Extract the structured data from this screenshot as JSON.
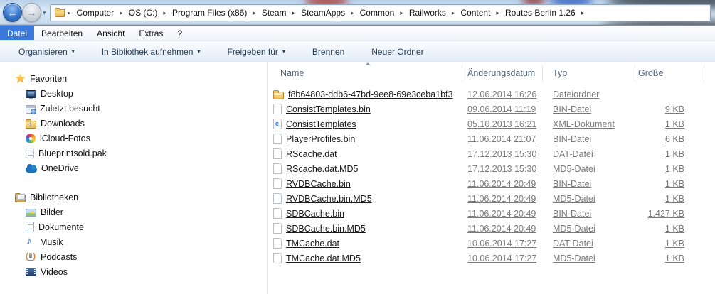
{
  "breadcrumb": {
    "items": [
      "Computer",
      "OS (C:)",
      "Program Files (x86)",
      "Steam",
      "SteamApps",
      "Common",
      "Railworks",
      "Content",
      "Routes Berlin 1.26"
    ],
    "folder_icon": "folder-icon",
    "separator_icon": "chevron-right-icon"
  },
  "nav": {
    "back_icon": "back-arrow-icon",
    "forward_icon": "forward-arrow-icon",
    "back_glyph": "←",
    "forward_glyph": "→",
    "history_dropdown_glyph": "▾"
  },
  "menubar": {
    "items": [
      {
        "label": "Datei",
        "active": true
      },
      {
        "label": "Bearbeiten",
        "active": false
      },
      {
        "label": "Ansicht",
        "active": false
      },
      {
        "label": "Extras",
        "active": false
      },
      {
        "label": "?",
        "active": false
      }
    ]
  },
  "toolbar": {
    "buttons": [
      {
        "label": "Organisieren",
        "dropdown": true
      },
      {
        "label": "In Bibliothek aufnehmen",
        "dropdown": true
      },
      {
        "label": "Freigeben für",
        "dropdown": true
      },
      {
        "label": "Brennen",
        "dropdown": false
      },
      {
        "label": "Neuer Ordner",
        "dropdown": false
      }
    ],
    "dropdown_glyph": "▾"
  },
  "sidebar": {
    "sections": [
      {
        "label": "Favoriten",
        "icon": "star-icon",
        "items": [
          {
            "label": "Desktop",
            "icon": "desktop-icon"
          },
          {
            "label": "Zuletzt besucht",
            "icon": "recent-places-icon"
          },
          {
            "label": "Downloads",
            "icon": "downloads-icon"
          },
          {
            "label": "iCloud-Fotos",
            "icon": "icloud-photos-icon"
          },
          {
            "label": "Blueprintsold.pak",
            "icon": "pak-file-icon"
          },
          {
            "label": "OneDrive",
            "icon": "onedrive-icon"
          }
        ]
      },
      {
        "label": "Bibliotheken",
        "icon": "libraries-icon",
        "items": [
          {
            "label": "Bilder",
            "icon": "pictures-icon"
          },
          {
            "label": "Dokumente",
            "icon": "documents-icon"
          },
          {
            "label": "Musik",
            "icon": "music-icon"
          },
          {
            "label": "Podcasts",
            "icon": "podcasts-icon"
          },
          {
            "label": "Videos",
            "icon": "videos-icon"
          }
        ]
      }
    ]
  },
  "file_list": {
    "columns": [
      "Name",
      "Änderungsdatum",
      "Typ",
      "Größe"
    ],
    "sort": {
      "column": "Name",
      "direction": "ascending"
    },
    "rows": [
      {
        "name": "f8b64803-ddb6-47bd-9ee8-69e3ceba1bf3",
        "date": "12.06.2014 16:26",
        "type": "Dateiordner",
        "size": "",
        "icon": "folder-icon"
      },
      {
        "name": "ConsistTemplates.bin",
        "date": "09.06.2014 11:19",
        "type": "BIN-Datei",
        "size": "9 KB",
        "icon": "file-icon"
      },
      {
        "name": "ConsistTemplates",
        "date": "05.10.2013 16:21",
        "type": "XML-Dokument",
        "size": "1 KB",
        "icon": "xml-file-icon"
      },
      {
        "name": "PlayerProfiles.bin",
        "date": "11.06.2014 21:07",
        "type": "BIN-Datei",
        "size": "6 KB",
        "icon": "file-icon"
      },
      {
        "name": "RScache.dat",
        "date": "17.12.2013 15:30",
        "type": "DAT-Datei",
        "size": "1 KB",
        "icon": "file-icon"
      },
      {
        "name": "RScache.dat.MD5",
        "date": "17.12.2013 15:30",
        "type": "MD5-Datei",
        "size": "1 KB",
        "icon": "file-icon"
      },
      {
        "name": "RVDBCache.bin",
        "date": "11.06.2014 20:49",
        "type": "BIN-Datei",
        "size": "1 KB",
        "icon": "file-icon"
      },
      {
        "name": "RVDBCache.bin.MD5",
        "date": "11.06.2014 20:49",
        "type": "MD5-Datei",
        "size": "1 KB",
        "icon": "file-icon"
      },
      {
        "name": "SDBCache.bin",
        "date": "11.06.2014 20:49",
        "type": "BIN-Datei",
        "size": "1.427 KB",
        "icon": "file-icon"
      },
      {
        "name": "SDBCache.bin.MD5",
        "date": "11.06.2014 20:49",
        "type": "MD5-Datei",
        "size": "1 KB",
        "icon": "file-icon"
      },
      {
        "name": "TMCache.dat",
        "date": "10.06.2014 17:27",
        "type": "DAT-Datei",
        "size": "1 KB",
        "icon": "file-icon"
      },
      {
        "name": "TMCache.dat.MD5",
        "date": "10.06.2014 17:27",
        "type": "MD5-Datei",
        "size": "1 KB",
        "icon": "file-icon"
      }
    ]
  },
  "colors": {
    "menu_highlight": "#3a78dc",
    "toolbar_text": "#1f3b57",
    "header_text": "#4f637b",
    "file_name_text": "#1a1a1a",
    "secondary_text": "#7a7a7a",
    "folder_yellow": "#e9b954",
    "glass_blue": "#c7d9ec"
  }
}
